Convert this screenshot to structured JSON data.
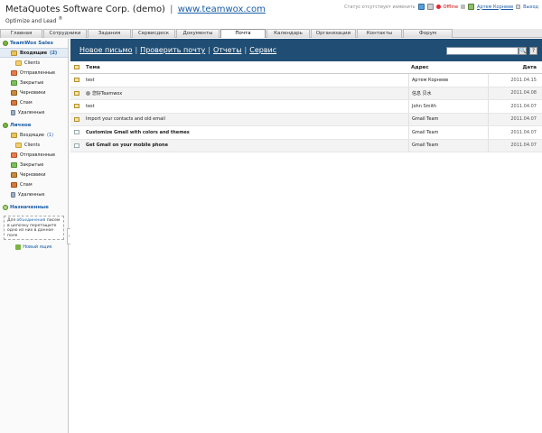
{
  "header": {
    "company": "MetaQuotes Software Corp. (demo)",
    "separator": "|",
    "site": "www.teamwox.com",
    "slogan": "Optimize and Lead",
    "slogan_mark": "®",
    "status": "Статус отсутствует изменить",
    "presence": "Offline",
    "user": "Артем Корнеев",
    "exit": "Выход"
  },
  "tabs": [
    {
      "label": "Главная",
      "width": 47
    },
    {
      "label": "Сотрудники",
      "width": 48
    },
    {
      "label": "Задания",
      "width": 48
    },
    {
      "label": "Сервисдеск",
      "width": 48
    },
    {
      "label": "Документы",
      "width": 48
    },
    {
      "label": "Почта",
      "width": 50,
      "active": true
    },
    {
      "label": "Календарь",
      "width": 48
    },
    {
      "label": "Организации",
      "width": 50
    },
    {
      "label": "Контакты",
      "width": 50
    },
    {
      "label": "Форум",
      "width": 55
    }
  ],
  "sidebar": {
    "group1": {
      "title": "TeamWox Sales",
      "inbox": "Входящие",
      "inbox_count": "(2)",
      "clients": "Clients",
      "sent": "Отправленные",
      "closed": "Закрытые",
      "drafts": "Черновики",
      "spam": "Спам",
      "deleted": "Удаленные"
    },
    "group2": {
      "title": "Личное",
      "inbox": "Входящие",
      "inbox_count": "(1)",
      "clients": "Clients",
      "sent": "Отправленные",
      "closed": "Закрытые",
      "drafts": "Черновики",
      "spam": "Спам",
      "deleted": "Удаленные"
    },
    "group3": {
      "title": "Назначенные"
    },
    "hint_pre": "Для ",
    "hint_link": "объединения",
    "hint_post": " писем в цепочку перетащите одно из них в данное поле",
    "new_folder": "Новый ящик",
    "collapse": "‹"
  },
  "toolbar": {
    "new_mail": "Новое письмо",
    "check_mail": "Проверить почту",
    "reports": "Отчеты",
    "service": "Сервис",
    "sep": "|",
    "search_placeholder": "",
    "search_btn": "🔍",
    "help_btn": "?"
  },
  "table": {
    "headers": {
      "subject": "Тема",
      "address": "Адрес",
      "date": "Дата"
    },
    "rows": [
      {
        "subject": "test",
        "address": "Артем Корнеев",
        "date": "2011.04.15",
        "bold": false,
        "avatar": false
      },
      {
        "subject": "您好Teamwox",
        "address": "信息 贝水",
        "date": "2011.04.08",
        "bold": false,
        "avatar": true
      },
      {
        "subject": "test",
        "address": "John Smith",
        "date": "2011.04.07",
        "bold": false,
        "avatar": false
      },
      {
        "subject": "Import your contacts and old email",
        "address": "Gmail Team",
        "date": "2011.04.07",
        "bold": false,
        "avatar": false
      },
      {
        "subject": "Customize Gmail with colors and themes",
        "address": "Gmail Team",
        "date": "2011.04.07",
        "bold": true,
        "avatar": false
      },
      {
        "subject": "Get Gmail on your mobile phone",
        "address": "Gmail Team",
        "date": "2011.04.07",
        "bold": true,
        "avatar": false
      }
    ]
  }
}
